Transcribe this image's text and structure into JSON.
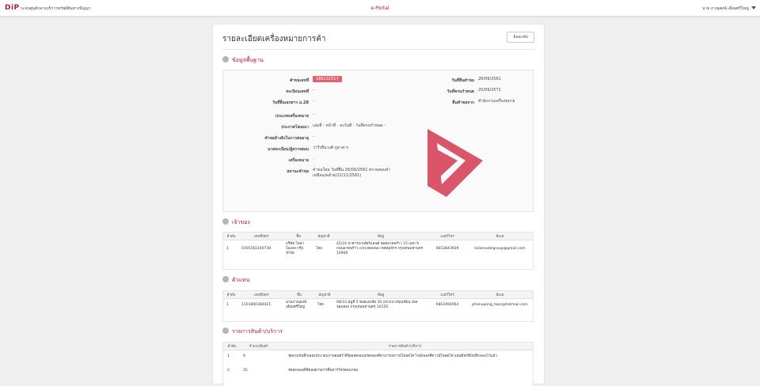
{
  "header": {
    "logo": "DiP",
    "org": "ระบบศูนย์กลางบริการทรัพย์สินทางปัญญา",
    "center": "e-Portal",
    "user": "นาย ภาณุพงษ์ เอี่ยมศรีใหญ่"
  },
  "page": {
    "title": "รายละเอียดเครื่องหมายการค้า",
    "back_label": "ย้อนกลับ"
  },
  "basic": {
    "section_title": "ข้อมูลพื้นฐาน",
    "left": [
      {
        "label": "คำขอเลขที่",
        "value": "180132517"
      },
      {
        "label": "ทะเบียนเลขที่",
        "value": "-"
      },
      {
        "label": "วันที่ยื่นเอกสาร ม.28",
        "value": "-"
      },
      {
        "label": "ประเภทเครื่องหมาย",
        "value": "-"
      },
      {
        "label": "ประกาศโฆษณา",
        "value": "เล่มที่ - หน้าที่ - ลงวันที่ - วันที่ครบกำหนด -"
      },
      {
        "label": "คำขออ้างอิงในการต่ออายุ",
        "value": "-"
      },
      {
        "label": "นายทะเบียน/ผู้ตรวจสอบ",
        "value": "ว่าวีรยืนวงศ์ ภูธาคาร"
      },
      {
        "label": "เครื่องหมาย",
        "value": "-"
      },
      {
        "label": "สถานะคำขอ",
        "value": "คำขอใหม่ วันที่ยื่น 26/09/2561 ตรวจสอบคำเหมือน/คล้าย(21/11/2561)"
      }
    ],
    "right": [
      {
        "label": "วันที่ยื่นคำขอ",
        "value": "26/09/2561"
      },
      {
        "label": "วันที่ครบกำหนด",
        "value": "25/09/2571"
      },
      {
        "label": "ยื่นคำขอจาก",
        "value": "สำนักงานเครื่องหมาย"
      }
    ],
    "logo_color": "#d9566a"
  },
  "owner": {
    "section_title": "เจ้าของ",
    "columns": [
      "ลำดับ",
      "เลขที่บัตร",
      "ชื่อ",
      "สัญชาติ",
      "ที่อยู่",
      "เบอร์โทร",
      "อีเมล"
    ],
    "rows": [
      [
        "1",
        "0105561160738",
        "บริษัท ไลล่า โมเดล กรุ๊ป จำกัด",
        "ไทย",
        "42/24 อาคารนาเดียร์แลนด์ ซอยลาดพร้าว 15 แยก 9 ถนนลาดพร้าว แขวงจอมพล เขตจตุจักร กรุงเทพมหานคร 10900",
        "0653843939",
        "lailamodelgroup@gmail.com"
      ]
    ]
  },
  "agent": {
    "section_title": "ตัวแทน",
    "columns": [
      "ลำดับ",
      "เลขที่บัตร",
      "ชื่อ",
      "สัญชาติ",
      "ที่อยู่",
      "เบอร์โทร",
      "อีเมล"
    ],
    "rows": [
      [
        "1",
        "1101800384421",
        "นายภาณุพงษ์ เอี่ยมศรีใหญ่",
        "ไทย",
        "68/33 หมู่ที่ 5 ซอยเอกชัย 30 แขวงบางขุนเทียน เขตจอมทอง กรุงเทพมหานคร 10150",
        "0863494064",
        "phanupong_toon@hotmail.com"
      ]
    ]
  },
  "goods": {
    "section_title": "รายการสินค้า/บริการ",
    "columns": [
      "ลำดับ",
      "จำพวกสินค้า",
      "รายการสินค้า/บริการ"
    ],
    "rows": [
      [
        "1",
        "9",
        "ชุดเกมบันทึกเพลงประกอบภาพยนตร์ ดิจิตอลคอมเพรสเพลงที่สามารถดาวน์โหลดได้ ไฟล์เพลงที่ดาวน์โหลดได้ แผ่นดิสก์ที่บันทึกเพลงไว้แล้ว"
      ],
      [
        "2",
        "35",
        "จัดส่งเพลงดิจิตอลผ่านการสื่อสารโทรคมนาคม"
      ]
    ]
  }
}
